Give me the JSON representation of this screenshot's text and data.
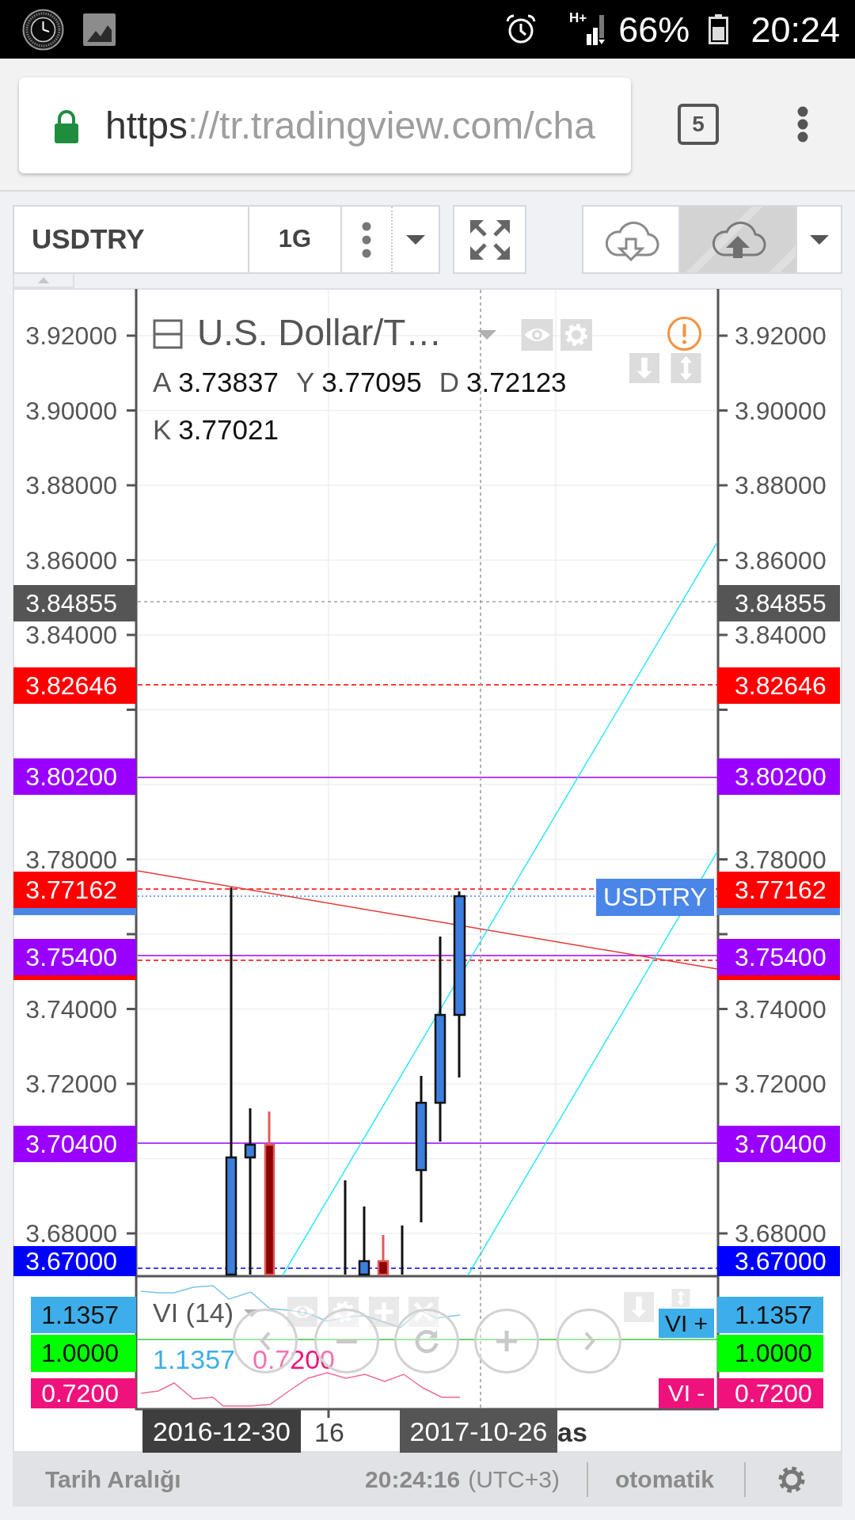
{
  "status_bar": {
    "network_type": "H+",
    "battery": "66%",
    "time": "20:24"
  },
  "browser": {
    "url": {
      "scheme": "https",
      "rest": "://tr.tradingview.com/cha"
    },
    "tab_count": "5"
  },
  "toolbar": {
    "symbol": "USDTRY",
    "interval": "1G",
    "cloud_buttons": [
      {
        "kind": "load",
        "disabled": false
      },
      {
        "kind": "save",
        "disabled": true
      }
    ]
  },
  "chart": {
    "legend": {
      "title": "U.S. Dollar/T…",
      "values": [
        {
          "key": "A",
          "value": "3.73837"
        },
        {
          "key": "Y",
          "value": "3.77095"
        },
        {
          "key": "D",
          "value": "3.72123"
        },
        {
          "key": "K",
          "value": "3.77021"
        }
      ]
    },
    "symbol_tag": "USDTRY",
    "left_axis": {
      "ticks": [
        "3.92000",
        "3.90000",
        "3.88000",
        "3.86000",
        "3.84000",
        "3.78000",
        "3.74000",
        "3.72000",
        "3.68000"
      ],
      "price_labels": [
        {
          "text": "3.84855",
          "color": "#555555"
        },
        {
          "text": "3.82646",
          "color": "#ff0000"
        },
        {
          "text": "3.80200",
          "color": "#9900ff"
        },
        {
          "text": "3.77162",
          "color": "#ff0000"
        },
        {
          "text": "3.75400",
          "color": "#9900ff"
        },
        {
          "text": "3.70400",
          "color": "#9900ff"
        },
        {
          "text": "3.67000",
          "color": "#0000ff"
        }
      ],
      "label_edges": [
        {
          "color": "#4a86e8"
        },
        {
          "color": "#ff0000"
        }
      ]
    },
    "right_axis": {
      "ticks": [
        "3.92000",
        "3.90000",
        "3.88000",
        "3.86000",
        "3.84000",
        "3.78000",
        "3.74000",
        "3.72000",
        "3.68000"
      ],
      "price_labels": [
        {
          "text": "3.84855",
          "color": "#555555"
        },
        {
          "text": "3.82646",
          "color": "#ff0000"
        },
        {
          "text": "3.80200",
          "color": "#9900ff"
        },
        {
          "text": "3.77162",
          "color": "#ff0000"
        },
        {
          "text": "3.75400",
          "color": "#9900ff"
        },
        {
          "text": "3.70400",
          "color": "#9900ff"
        },
        {
          "text": "3.67000",
          "color": "#0000ff"
        }
      ],
      "label_edges": [
        {
          "color": "#4a86e8"
        },
        {
          "color": "#ff0000"
        }
      ]
    },
    "indicator": {
      "title": "VI (14)",
      "values": [
        {
          "text": "1.1357",
          "color": "#3daee9"
        },
        {
          "text": "0.7200",
          "color": "#f0127c"
        }
      ],
      "tags": [
        {
          "text": "VI +",
          "color": "#3daee9"
        },
        {
          "text": "VI -",
          "color": "#f0127c"
        }
      ],
      "left_labels": [
        {
          "text": "1.1357",
          "color": "#3daee9"
        },
        {
          "text": "1.0000",
          "color": "#00ff00"
        },
        {
          "text": "0.7200",
          "color": "#f0127c"
        }
      ],
      "right_labels": [
        {
          "text": "1.1357",
          "color": "#3daee9"
        },
        {
          "text": "1.0000",
          "color": "#00ff00"
        },
        {
          "text": "0.7200",
          "color": "#f0127c"
        }
      ]
    },
    "time_axis": {
      "labels": [
        {
          "text": "2016-12-30",
          "kind": "marker"
        },
        {
          "text": "16",
          "kind": "tick"
        },
        {
          "text": "2017-10-26",
          "kind": "crosshair"
        },
        {
          "text": "as",
          "kind": "month"
        }
      ]
    }
  },
  "footer": {
    "range_button": "Tarih Aralığı",
    "clock": "20:24:16",
    "timezone": "(UTC+3)",
    "scale_mode": "otomatik"
  }
}
